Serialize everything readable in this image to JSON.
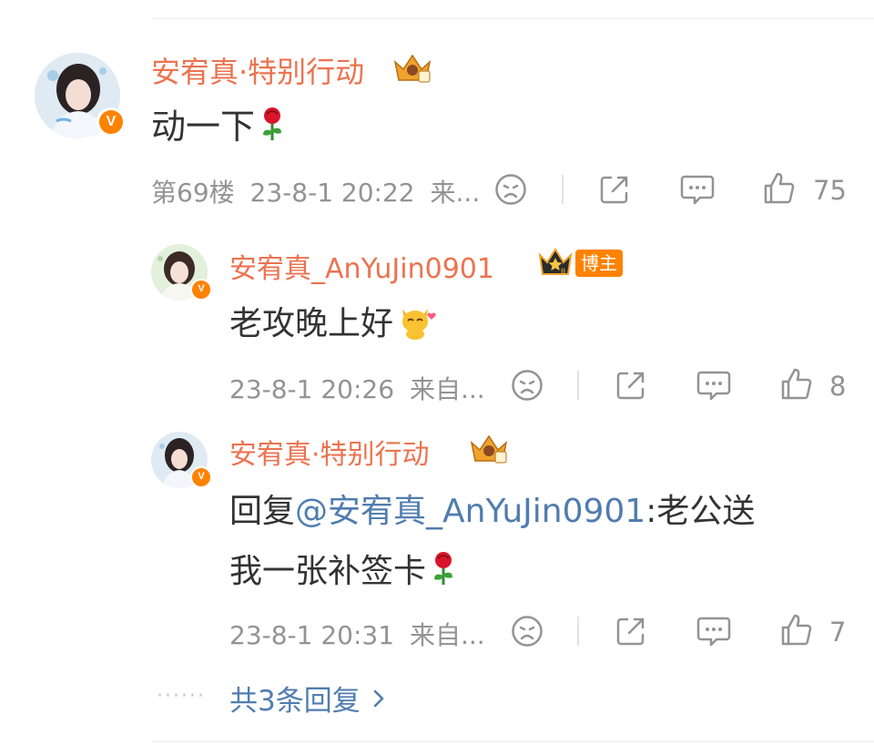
{
  "comment": {
    "username": "安宥真·特别行动",
    "text": "动一下",
    "floor": "第69楼",
    "time": "23-8-1 20:22",
    "source": "来...",
    "likes": "75"
  },
  "replies": [
    {
      "username": "安宥真_AnYuJin0901",
      "tag": "博主",
      "text": "老攻晚上好",
      "time": "23-8-1 20:26",
      "source": "来自...",
      "likes": "8"
    },
    {
      "username": "安宥真·特别行动",
      "reply_prefix": "回复",
      "mention": "@安宥真_AnYuJin0901",
      "text_line1": ":老公送",
      "text_line2": "我一张补签卡",
      "time": "23-8-1 20:31",
      "source": "来自...",
      "likes": "7"
    }
  ],
  "more_replies": {
    "dots": "······",
    "label": "共3条回复"
  },
  "colors": {
    "username": "#eb7350",
    "link": "#507daf",
    "meta": "#939393",
    "verified_badge": "#ff8200"
  },
  "icons": [
    "dislike-icon",
    "share-icon",
    "comment-icon",
    "like-icon",
    "rose-icon",
    "crown-icon",
    "chevron-right-icon"
  ]
}
